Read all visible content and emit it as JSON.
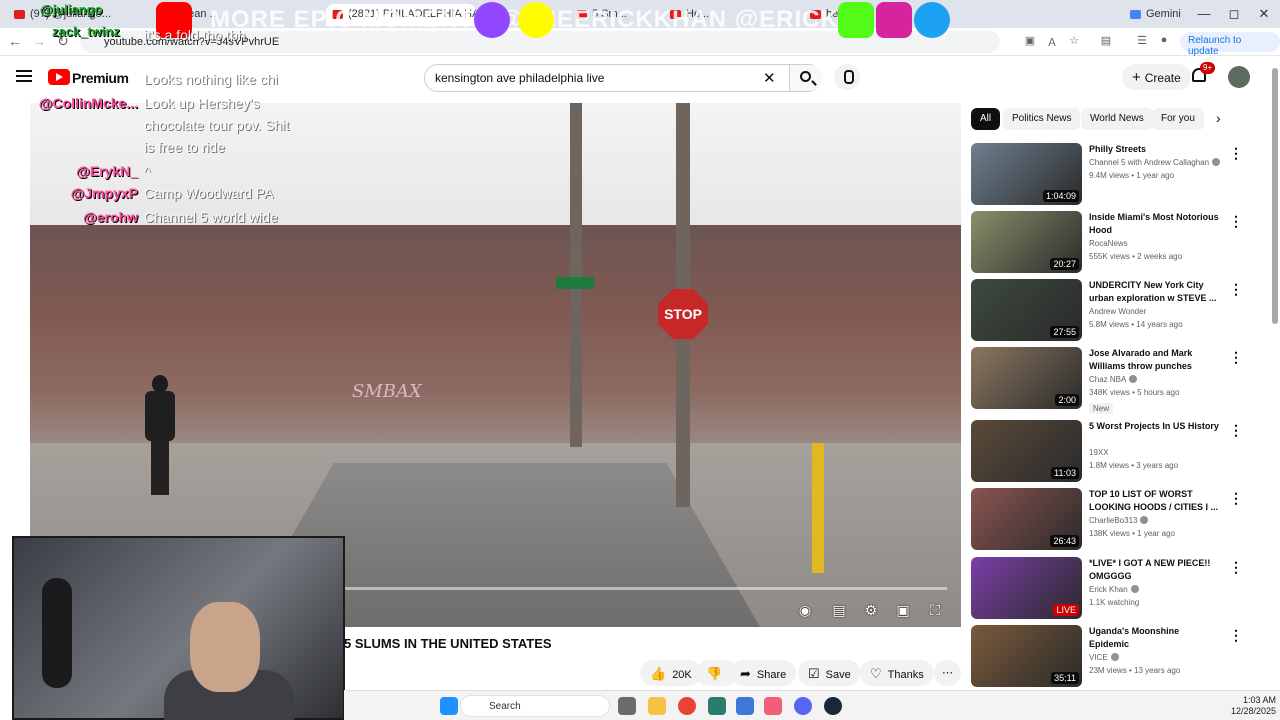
{
  "browser": {
    "tabs": [
      {
        "label": "(97) @juliango..."
      },
      {
        "label": "Lean ..."
      },
      {
        "label": "(2821) PHILADELPHIA HAS THE"
      },
      {
        "label": "5 Sm..."
      },
      {
        "label": "He..."
      },
      {
        "label": "hers"
      },
      {
        "label": "Gemini"
      }
    ],
    "url": "youtube.com/watch?v=J4sVPvhrUE",
    "relaunch_label": "Relaunch to update"
  },
  "youtube": {
    "brand": "Premium",
    "search_value": "kensington ave philadelphia live",
    "create_label": "Create",
    "notifications_badge": "9+",
    "video_title": "5 SLUMS IN THE UNITED STATES",
    "actions": {
      "likes": "20K",
      "share": "Share",
      "save": "Save",
      "thanks": "Thanks"
    },
    "chips": [
      "All",
      "Politics News",
      "World News",
      "For you"
    ],
    "recommendations": [
      {
        "title": "Philly Streets",
        "channel": "Channel 5 with Andrew Callaghan",
        "verified": true,
        "meta": "9.4M views • 1 year ago",
        "duration": "1:04:09",
        "badge": "",
        "thumb": "#6f7f8f"
      },
      {
        "title": "Inside Miami's Most Notorious Hood",
        "channel": "RocaNews",
        "verified": false,
        "meta": "555K views • 2 weeks ago",
        "duration": "20:27",
        "badge": "",
        "thumb": "#8a8f6a"
      },
      {
        "title": "UNDERCITY New York City urban exploration w STEVE ...",
        "channel": "Andrew Wonder",
        "verified": false,
        "meta": "5.8M views • 14 years ago",
        "duration": "27:55",
        "badge": "",
        "thumb": "#3d4a3f"
      },
      {
        "title": "Jose Alvarado and Mark Williams throw punches durin...",
        "channel": "Chaz NBA",
        "verified": true,
        "meta": "348K views • 5 hours ago",
        "duration": "2:00",
        "badge": "New",
        "thumb": "#8c7760"
      },
      {
        "title": "5 Worst Projects In US History",
        "channel": "19XX",
        "verified": false,
        "meta": "1.8M views • 3 years ago",
        "duration": "11:03",
        "badge": "",
        "thumb": "#5a4a3a"
      },
      {
        "title": "TOP 10 LIST OF WORST LOOKING HOODS / CITIES I ...",
        "channel": "CharlieBo313",
        "verified": true,
        "meta": "138K views • 1 year ago",
        "duration": "26:43",
        "badge": "",
        "thumb": "#8a5450"
      },
      {
        "title": "*LIVE* I GOT A NEW PIECE!! OMGGGG",
        "channel": "Erick Khan",
        "verified": true,
        "meta": "1.1K watching",
        "duration": "LIVE",
        "badge": "",
        "thumb": "#7b3fa8"
      },
      {
        "title": "Uganda's Moonshine Epidemic",
        "channel": "VICE",
        "verified": true,
        "meta": "23M views • 13 years ago",
        "duration": "35:11",
        "badge": "",
        "thumb": "#7a5a3a"
      }
    ]
  },
  "stream_overlay": {
    "banner_users": [
      "@juliango",
      "zack_twinz"
    ],
    "banner_text": "MORE EPIC MOMENTS @THEERICKKHAN @ERICKKHAN",
    "chat": [
      {
        "user": "",
        "message": "it's a fold tho tbh"
      },
      {
        "user": "",
        "message": "Looks nothing like chi"
      },
      {
        "user": "@CollinMcke...",
        "message": "Look up Hershey's"
      },
      {
        "user": "",
        "message": "chocolate tour pov. Shit"
      },
      {
        "user": "",
        "message": "is free to ride"
      },
      {
        "user": "@ErykN_",
        "message": "^"
      },
      {
        "user": "@JmpyxP",
        "message": "Camp Woodward PA"
      },
      {
        "user": "@erohw",
        "message": "Channel 5 world wide"
      }
    ]
  },
  "video_scene": {
    "stop_sign": "STOP",
    "graffiti": "SMBAX"
  },
  "taskbar": {
    "search_placeholder": "Search",
    "time": "1:03 AM",
    "date": "12/28/2025"
  },
  "colors": {
    "youtube_red": "#ff0000",
    "chat_username": "#ff4fa0",
    "banner_user": "#22aa33",
    "relaunch_blue": "#1a73e8"
  }
}
